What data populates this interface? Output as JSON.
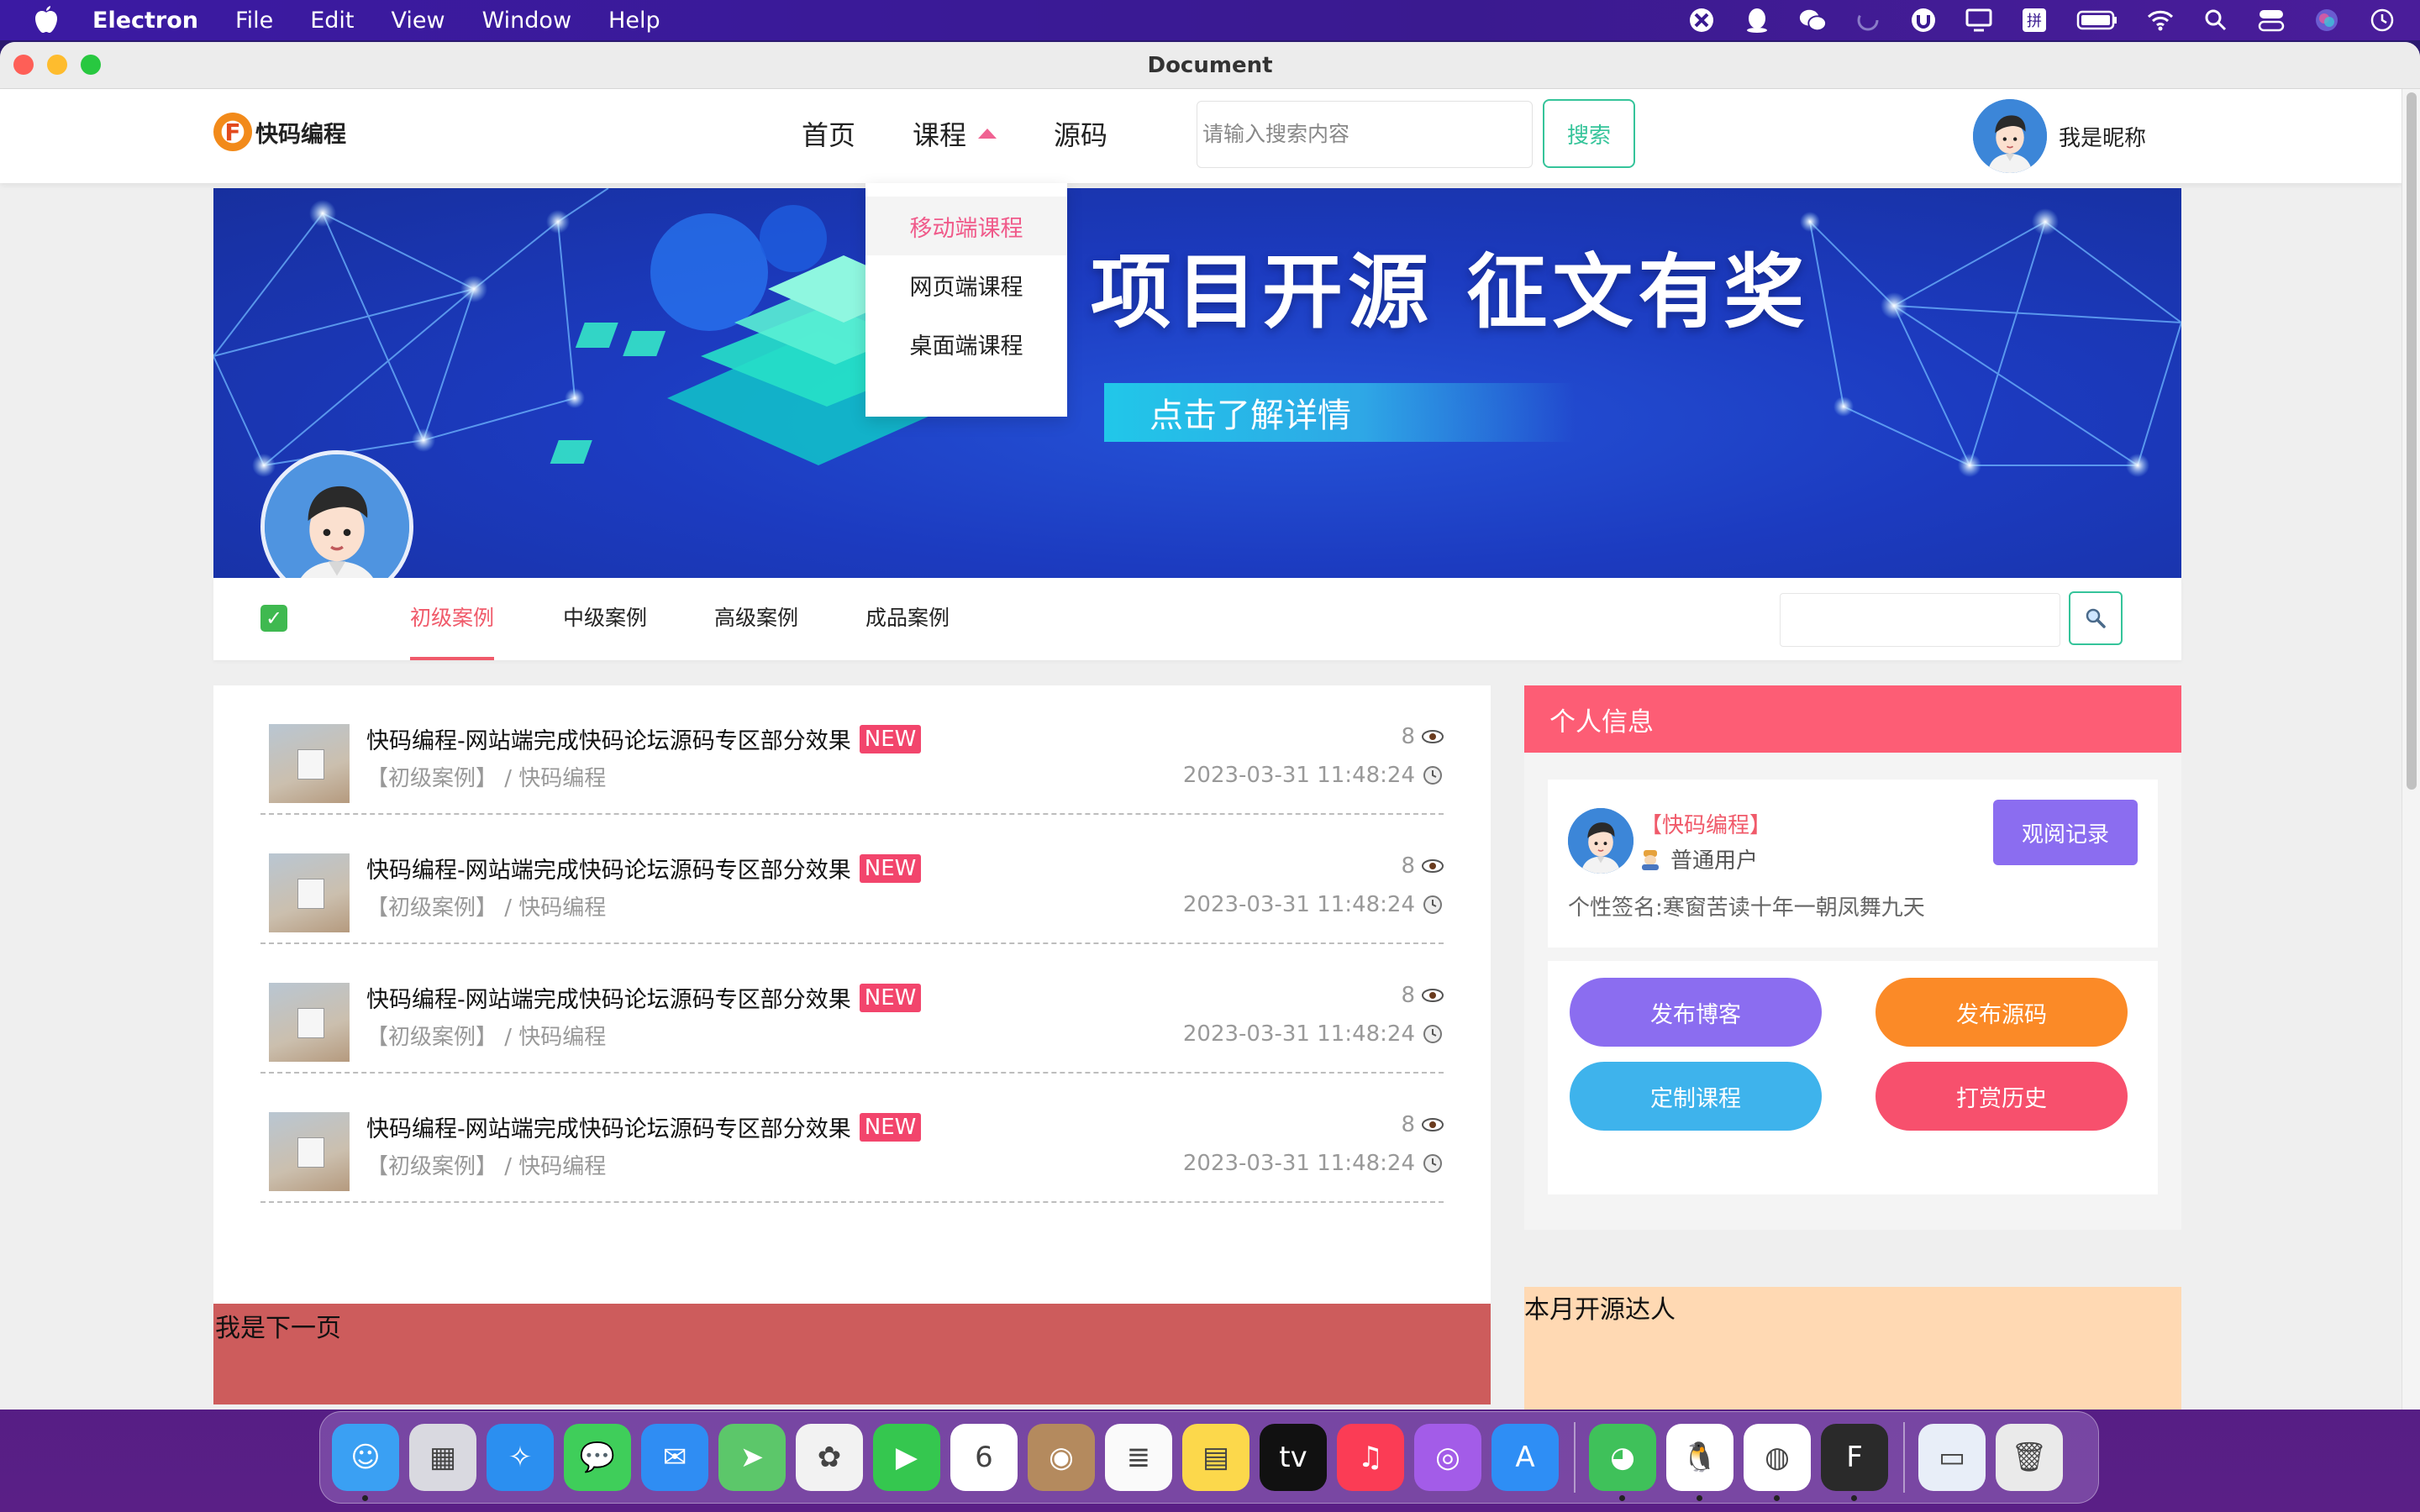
{
  "menubar": {
    "app_name": "Electron",
    "items": [
      "File",
      "Edit",
      "View",
      "Window",
      "Help"
    ]
  },
  "window": {
    "title": "Document"
  },
  "header": {
    "logo_text": "快码编程",
    "logo_mark": "F",
    "nav": [
      "首页",
      "课程",
      "源码"
    ],
    "search_placeholder": "请输入搜索内容",
    "search_button": "搜索",
    "nickname": "我是昵称"
  },
  "dropdown": {
    "items": [
      "移动端课程",
      "网页端课程",
      "桌面端课程"
    ],
    "active_index": 0
  },
  "banner": {
    "headline": "项目开源  征文有奖",
    "cta": "点击了解详情"
  },
  "tabs": {
    "items": [
      "初级案例",
      "中级案例",
      "高级案例",
      "成品案例"
    ],
    "active_index": 0,
    "check_glyph": "✓"
  },
  "articles": [
    {
      "title": "快码编程-网站端完成快码论坛源码专区部分效果",
      "badge": "NEW",
      "meta": "【初级案例】 / 快码编程",
      "views": "8",
      "date": "2023-03-31 11:48:24"
    },
    {
      "title": "快码编程-网站端完成快码论坛源码专区部分效果",
      "badge": "NEW",
      "meta": "【初级案例】 / 快码编程",
      "views": "8",
      "date": "2023-03-31 11:48:24"
    },
    {
      "title": "快码编程-网站端完成快码论坛源码专区部分效果",
      "badge": "NEW",
      "meta": "【初级案例】 / 快码编程",
      "views": "8",
      "date": "2023-03-31 11:48:24"
    },
    {
      "title": "快码编程-网站端完成快码论坛源码专区部分效果",
      "badge": "NEW",
      "meta": "【初级案例】 / 快码编程",
      "views": "8",
      "date": "2023-03-31 11:48:24"
    }
  ],
  "next_page": "我是下一页",
  "profile": {
    "header": "个人信息",
    "name": "【快码编程】",
    "role": "普通用户",
    "signature": "个性签名:寒窗苦读十年一朝凤舞九天",
    "history_button": "观阅记录",
    "actions": [
      {
        "label": "发布博客",
        "color": "#8b6df0"
      },
      {
        "label": "发布源码",
        "color": "#fb8a27"
      },
      {
        "label": "定制课程",
        "color": "#3eb3ec"
      },
      {
        "label": "打赏历史",
        "color": "#f7506d"
      }
    ]
  },
  "top_creators": {
    "title": "本月开源达人"
  },
  "dock": {
    "icons": [
      {
        "name": "finder-icon",
        "color": "#3aa0f3",
        "glyph": "☺",
        "running": true
      },
      {
        "name": "launchpad-icon",
        "color": "#d9d9e0",
        "glyph": "▦",
        "running": false
      },
      {
        "name": "safari-icon",
        "color": "#2b8ff0",
        "glyph": "✧",
        "running": false
      },
      {
        "name": "messages-icon",
        "color": "#3fce5a",
        "glyph": "💬",
        "running": false
      },
      {
        "name": "mail-icon",
        "color": "#2f8df3",
        "glyph": "✉",
        "running": false
      },
      {
        "name": "maps-icon",
        "color": "#5cc76a",
        "glyph": "➤",
        "running": false
      },
      {
        "name": "photos-icon",
        "color": "#f2f2f2",
        "glyph": "✿",
        "running": false
      },
      {
        "name": "facetime-icon",
        "color": "#35c74f",
        "glyph": "▶",
        "running": false
      },
      {
        "name": "calendar-icon",
        "color": "#ffffff",
        "glyph": "6",
        "running": false
      },
      {
        "name": "contacts-icon",
        "color": "#b48a5e",
        "glyph": "◉",
        "running": false
      },
      {
        "name": "reminders-icon",
        "color": "#fafafa",
        "glyph": "≣",
        "running": false
      },
      {
        "name": "notes-icon",
        "color": "#fcd84b",
        "glyph": "▤",
        "running": false
      },
      {
        "name": "apple-tv-icon",
        "color": "#111111",
        "glyph": "tv",
        "running": false
      },
      {
        "name": "music-icon",
        "color": "#fb3c55",
        "glyph": "♫",
        "running": false
      },
      {
        "name": "podcasts-icon",
        "color": "#a35ce8",
        "glyph": "◎",
        "running": false
      },
      {
        "name": "app-store-icon",
        "color": "#2e8ef5",
        "glyph": "A",
        "running": false
      },
      {
        "name": "separator",
        "color": "",
        "glyph": "",
        "running": false
      },
      {
        "name": "wechat-icon",
        "color": "#3fc15a",
        "glyph": "◕",
        "running": true
      },
      {
        "name": "qq-icon",
        "color": "#ffffff",
        "glyph": "🐧",
        "running": true
      },
      {
        "name": "chrome-icon",
        "color": "#ffffff",
        "glyph": "◍",
        "running": true
      },
      {
        "name": "kuaima-app-icon",
        "color": "#2a2a2a",
        "glyph": "F",
        "running": true
      },
      {
        "name": "separator",
        "color": "",
        "glyph": "",
        "running": false
      },
      {
        "name": "preview-window-icon",
        "color": "#e8eef8",
        "glyph": "▭",
        "running": false
      },
      {
        "name": "trash-icon",
        "color": "#eaeaea",
        "glyph": "🗑",
        "running": false
      }
    ]
  }
}
